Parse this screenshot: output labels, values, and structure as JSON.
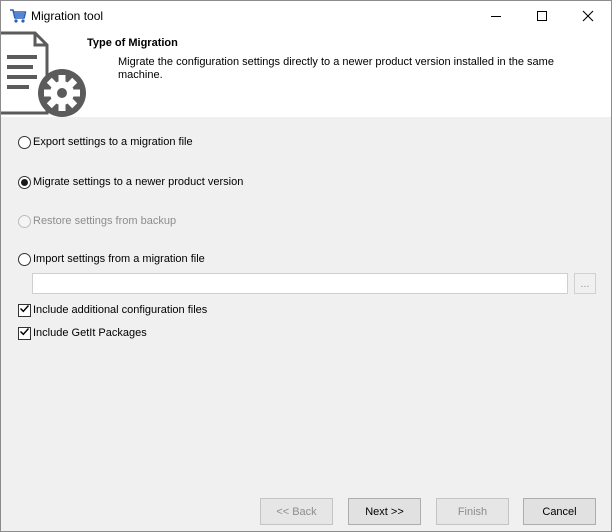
{
  "window": {
    "title": "Migration tool",
    "icon": "cart-icon"
  },
  "header": {
    "title": "Type of Migration",
    "description": "Migrate the configuration settings directly to a newer product version installed in the same machine.",
    "icon": "settings-document-icon"
  },
  "options": [
    {
      "label": "Export settings to a migration file",
      "selected": false,
      "enabled": true
    },
    {
      "label": "Migrate settings to a newer product version",
      "selected": true,
      "enabled": true
    },
    {
      "label": "Restore settings from backup",
      "selected": false,
      "enabled": false
    },
    {
      "label": "Import settings from a migration file",
      "selected": false,
      "enabled": true
    }
  ],
  "import_file": {
    "value": "",
    "browse_label": "..."
  },
  "checkboxes": [
    {
      "label": "Include additional configuration files",
      "checked": true
    },
    {
      "label": "Include GetIt Packages",
      "checked": true
    }
  ],
  "buttons": {
    "back": "<< Back",
    "next": "Next >>",
    "finish": "Finish",
    "cancel": "Cancel"
  }
}
